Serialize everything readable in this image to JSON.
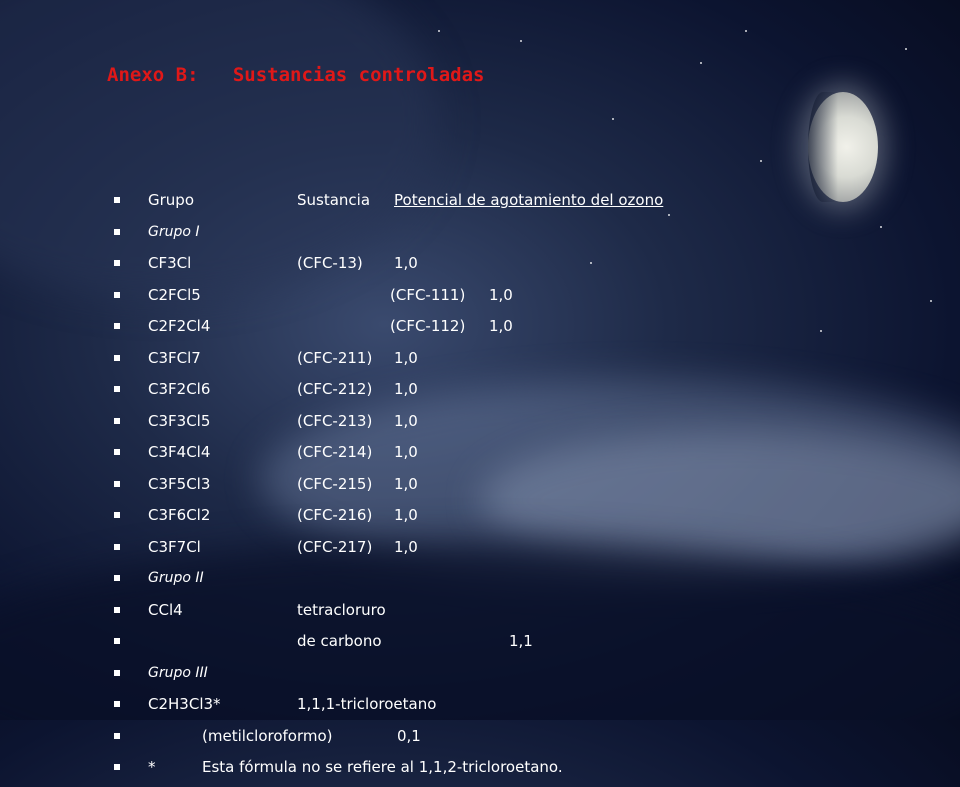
{
  "title": {
    "annex": "Anexo B:",
    "heading": "Sustancias controladas"
  },
  "header": {
    "col1": "Grupo",
    "col2": "Sustancia",
    "col3": "Potencial de agotamiento del ozono"
  },
  "groups": {
    "g1": "Grupo I",
    "g2": "Grupo II",
    "g3": "Grupo III"
  },
  "group1_rows": [
    {
      "formula": "CF3Cl",
      "code": "(CFC-13)",
      "odp": "1,0"
    },
    {
      "formula": "C2FCl5",
      "code": "(CFC-111)",
      "odp": "1,0"
    },
    {
      "formula": "C2F2Cl4",
      "code": "(CFC-112)",
      "odp": "1,0"
    },
    {
      "formula": "C3FCl7",
      "code": "(CFC-211)",
      "odp": "1,0"
    },
    {
      "formula": "C3F2Cl6",
      "code": "(CFC-212)",
      "odp": "1,0"
    },
    {
      "formula": "C3F3Cl5",
      "code": "(CFC-213)",
      "odp": "1,0"
    },
    {
      "formula": "C3F4Cl4",
      "code": "(CFC-214)",
      "odp": "1,0"
    },
    {
      "formula": "C3F5Cl3",
      "code": "(CFC-215)",
      "odp": "1,0"
    },
    {
      "formula": "C3F6Cl2",
      "code": "(CFC-216)",
      "odp": "1,0"
    },
    {
      "formula": "C3F7Cl",
      "code": "(CFC-217)",
      "odp": "1,0"
    }
  ],
  "group2": {
    "formula": "CCl4",
    "name_line1": "tetracloruro",
    "name_line2": "de carbono",
    "odp": "1,1"
  },
  "group3": {
    "formula": "C2H3Cl3*",
    "name": "1,1,1-tricloroetano",
    "alias": "(metilcloroformo)",
    "odp": "0,1"
  },
  "footnote": {
    "mark": "*",
    "text": "Esta fórmula no se refiere al 1,1,2-tricloroetano."
  }
}
